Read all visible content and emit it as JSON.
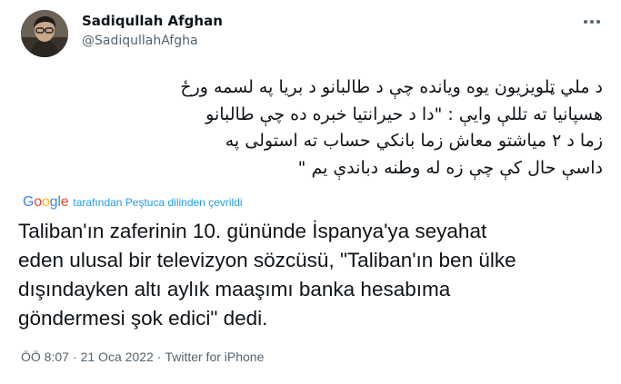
{
  "author": {
    "name": "Sadiqullah Afghan",
    "handle": "@SadiqullahAfgha"
  },
  "tweet": {
    "original_lines": [
      "د ملي ټلویزیون یوه ویانده چې د طالبانو د بریا په لسمه ورځ",
      "هسپانیا ته تللې وایې : \"دا د حیرانتیا خبره ده چې طالبانو",
      "زما د ۲ میاشتو معاش زما بانکي حساب ته استولی په",
      "داسې حال کې چې زه له وطنه دباندې یم \""
    ],
    "translation_label": "tarafından Peştuca dilinden çevrildi",
    "translation_lines": [
      "Taliban'ın zaferinin 10. gününde İspanya'ya seyahat",
      "eden ulusal bir televizyon sözcüsü, \"Taliban'ın ben ülke",
      "dışındayken altı aylık maaşımı banka hesabıma",
      "göndermesi şok edici\" dedi."
    ]
  },
  "meta": {
    "time": "ÖÖ 8:07",
    "date": "21 Oca 2022",
    "source": "Twitter for iPhone",
    "separator": "·"
  },
  "google_logo": {
    "letters": [
      "G",
      "o",
      "o",
      "g",
      "l",
      "e"
    ],
    "colors": [
      "#4285F4",
      "#EA4335",
      "#FBBC05",
      "#4285F4",
      "#34A853",
      "#EA4335"
    ]
  },
  "colors": {
    "text": "#0f1419",
    "secondary": "#536471",
    "link": "#1d9bf0"
  }
}
